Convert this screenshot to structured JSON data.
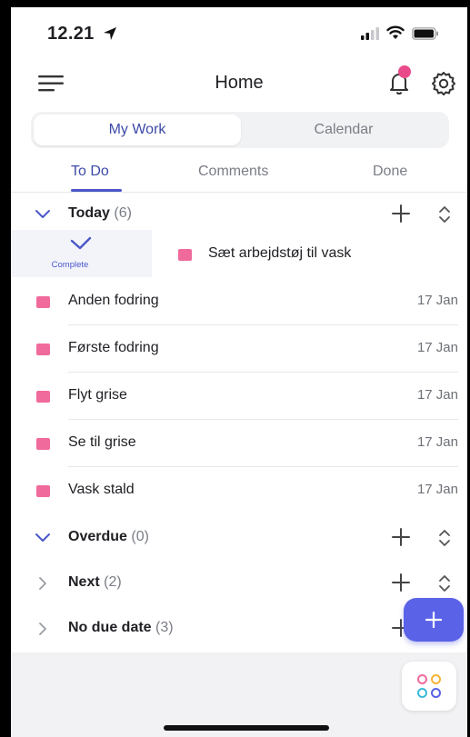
{
  "status_bar": {
    "time": "12.21"
  },
  "header": {
    "title": "Home"
  },
  "segment": {
    "active": "My Work",
    "inactive": "Calendar"
  },
  "tabs": {
    "todo": "To Do",
    "comments": "Comments",
    "done": "Done"
  },
  "sections": {
    "today": {
      "name": "Today",
      "count": "(6)"
    },
    "overdue": {
      "name": "Overdue",
      "count": "(0)"
    },
    "next": {
      "name": "Next",
      "count": "(2)"
    },
    "no_due_date": {
      "name": "No due date",
      "count": "(3)"
    }
  },
  "swiped_task": {
    "action_label": "Complete",
    "label": "Sæt arbejdstøj til vask"
  },
  "tasks": [
    {
      "label": "Anden fodring",
      "date": "17 Jan"
    },
    {
      "label": "Første fodring",
      "date": "17 Jan"
    },
    {
      "label": "Flyt grise",
      "date": "17 Jan"
    },
    {
      "label": "Se til grise",
      "date": "17 Jan"
    },
    {
      "label": "Vask stald",
      "date": "17 Jan"
    }
  ],
  "icons": {
    "location": "location-arrow-icon",
    "signal": "cell-signal-icon",
    "wifi": "wifi-icon",
    "battery": "battery-icon",
    "menu": "hamburger-menu-icon",
    "notification": "bell-icon",
    "settings": "gear-icon",
    "expand": "chevron-down-icon",
    "collapse": "chevron-right-icon",
    "add": "plus-icon",
    "sort": "sort-icon",
    "complete": "checkmark-icon",
    "apps": "apps-grid-icon"
  },
  "colors": {
    "accent": "#4a56c9",
    "task_color": "#f06a9c",
    "fab": "#5a62e8",
    "badge": "#e94b8a"
  }
}
